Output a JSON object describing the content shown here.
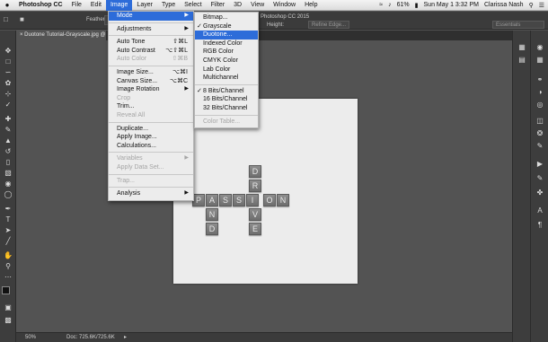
{
  "menubar": {
    "apple": "",
    "items": [
      "Photoshop CC",
      "File",
      "Edit",
      "Image",
      "Layer",
      "Type",
      "Select",
      "Filter",
      "3D",
      "View",
      "Window",
      "Help"
    ],
    "active": "Image",
    "battery": "61%",
    "datetime": "Sun May 1  3:32 PM",
    "user": "Clarissa Nash"
  },
  "window_title": "Photoshop CC 2015",
  "options": {
    "feather_label": "Feather:",
    "feather_value": "0 px",
    "height_label": "Height:",
    "refine_edge": "Refine Edge...",
    "workspace": "Essentials"
  },
  "document": {
    "tab_label": "Duotone Tutorial-Grayscale.jpg @"
  },
  "image_menu": {
    "items": [
      {
        "label": "Mode",
        "arrow": true,
        "highlight": true
      },
      {
        "sep": true
      },
      {
        "label": "Adjustments",
        "arrow": true
      },
      {
        "sep": true
      },
      {
        "label": "Auto Tone",
        "shortcut": "⇧⌘L"
      },
      {
        "label": "Auto Contrast",
        "shortcut": "⌥⇧⌘L"
      },
      {
        "label": "Auto Color",
        "shortcut": "⇧⌘B",
        "disabled": true
      },
      {
        "sep": true
      },
      {
        "label": "Image Size...",
        "shortcut": "⌥⌘I"
      },
      {
        "label": "Canvas Size...",
        "shortcut": "⌥⌘C"
      },
      {
        "label": "Image Rotation",
        "arrow": true
      },
      {
        "label": "Crop",
        "disabled": true
      },
      {
        "label": "Trim..."
      },
      {
        "label": "Reveal All",
        "disabled": true
      },
      {
        "sep": true
      },
      {
        "label": "Duplicate..."
      },
      {
        "label": "Apply Image..."
      },
      {
        "label": "Calculations..."
      },
      {
        "sep": true
      },
      {
        "label": "Variables",
        "arrow": true,
        "disabled": true
      },
      {
        "label": "Apply Data Set...",
        "disabled": true
      },
      {
        "sep": true
      },
      {
        "label": "Trap...",
        "disabled": true
      },
      {
        "sep": true
      },
      {
        "label": "Analysis",
        "arrow": true
      }
    ]
  },
  "mode_menu": {
    "items": [
      {
        "label": "Bitmap..."
      },
      {
        "label": "Grayscale",
        "checked": true
      },
      {
        "label": "Duotone...",
        "highlight": true
      },
      {
        "label": "Indexed Color"
      },
      {
        "label": "RGB Color"
      },
      {
        "label": "CMYK Color"
      },
      {
        "label": "Lab Color"
      },
      {
        "label": "Multichannel"
      },
      {
        "sep": true
      },
      {
        "label": "8 Bits/Channel",
        "checked": true
      },
      {
        "label": "16 Bits/Channel"
      },
      {
        "label": "32 Bits/Channel"
      },
      {
        "sep": true
      },
      {
        "label": "Color Table...",
        "disabled": true
      }
    ]
  },
  "tiles": {
    "passion": [
      "P",
      "A",
      "S",
      "S",
      "I",
      "O",
      "N"
    ],
    "drive": [
      "D",
      "R",
      "I",
      "V",
      "E"
    ],
    "and": [
      "A",
      "N",
      "D"
    ]
  },
  "status": {
    "zoom": "50%",
    "doc": "Doc: 725.6K/725.6K"
  }
}
